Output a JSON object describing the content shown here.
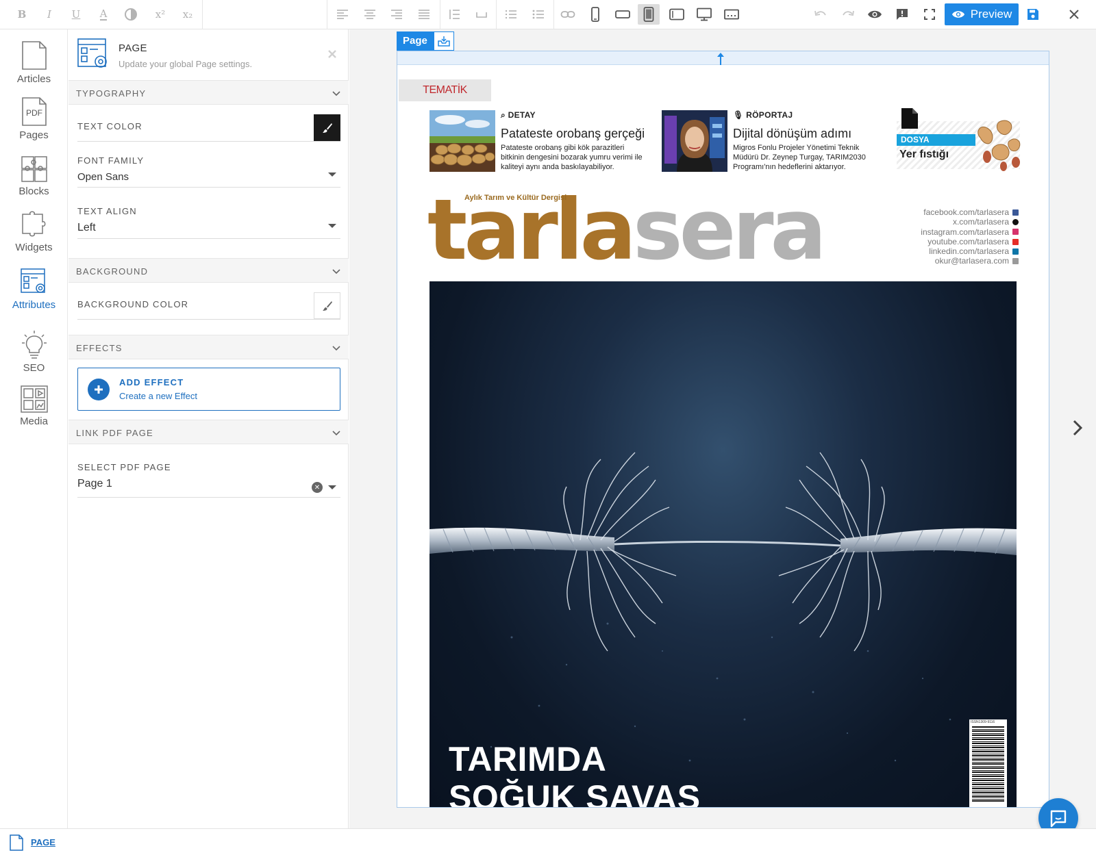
{
  "toolbar": {
    "superscript_label": "x²",
    "subscript_label": "x₂",
    "preview_label": "Preview"
  },
  "rail": {
    "items": [
      {
        "label": "Articles",
        "icon": "document-icon"
      },
      {
        "label": "Pages",
        "icon": "pdf-page-icon",
        "badge": "PDF"
      },
      {
        "label": "Blocks",
        "icon": "puzzle-grid-icon"
      },
      {
        "label": "Widgets",
        "icon": "puzzle-piece-icon"
      },
      {
        "label": "Attributes",
        "icon": "page-settings-icon",
        "active": true
      },
      {
        "label": "SEO",
        "icon": "lightbulb-icon"
      },
      {
        "label": "Media",
        "icon": "media-grid-icon"
      }
    ]
  },
  "panel": {
    "title": "PAGE",
    "subtitle": "Update your global Page settings.",
    "sections": {
      "typography": "TYPOGRAPHY",
      "background": "BACKGROUND",
      "effects": "EFFECTS",
      "link_pdf": "LINK PDF PAGE"
    },
    "text_color": {
      "label": "TEXT COLOR",
      "value": "#1a1a1a"
    },
    "font_family": {
      "label": "FONT FAMILY",
      "value": "Open Sans"
    },
    "text_align": {
      "label": "TEXT ALIGN",
      "value": "Left"
    },
    "background_color": {
      "label": "BACKGROUND COLOR",
      "value": "#ffffff"
    },
    "add_effect": {
      "title": "ADD EFFECT",
      "subtitle": "Create a new Effect"
    },
    "select_pdf_page": {
      "label": "SELECT PDF PAGE",
      "value": "Page 1"
    }
  },
  "canvas": {
    "page_tab_label": "Page",
    "magazine": {
      "tematik_label": "TEMATİK",
      "teasers": [
        {
          "kicker": "DETAY",
          "title": "Patateste orobanş gerçeği",
          "desc": "Patateste orobanş gibi kök parazitleri bitkinin dengesini bozarak yumru verimi ile kaliteyi aynı anda baskılayabiliyor."
        },
        {
          "kicker": "RÖPORTAJ",
          "title": "Dijital dönüşüm adımı",
          "desc": "Migros Fonlu Projeler Yönetimi Teknik Müdürü Dr. Zeynep Turgay, TARIM2030 Programı'nın hedeflerini aktarıyor."
        }
      ],
      "dosya": {
        "label": "DOSYA",
        "title": "Yer fıstığı"
      },
      "masthead_tagline": "Aylık Tarım ve Kültür Dergisi",
      "masthead_part1": "tarla",
      "masthead_part2": "sera",
      "socials": [
        {
          "text": "facebook.com/tarlasera",
          "color": "#3b5998"
        },
        {
          "text": "x.com/tarlasera",
          "color": "#111111"
        },
        {
          "text": "instagram.com/tarlasera",
          "color": "#d6336c"
        },
        {
          "text": "youtube.com/tarlasera",
          "color": "#e52d27"
        },
        {
          "text": "linkedin.com/tarlasera",
          "color": "#0e76a8"
        },
        {
          "text": "okur@tarlasera.com",
          "color": "#9a9a9a"
        }
      ],
      "cover_headline_1": "TARIMDA",
      "cover_headline_2": "SOĞUK SAVAŞ",
      "barcode_text": "ISSN1309-9116"
    }
  },
  "statusbar": {
    "breadcrumb_label": "PAGE"
  },
  "colors": {
    "accent": "#1e88e5",
    "accent_dark": "#1e6fbf",
    "brand_gold": "#a8732a",
    "brand_gray": "#b2b2b2",
    "tematik_red": "#c0282d"
  }
}
